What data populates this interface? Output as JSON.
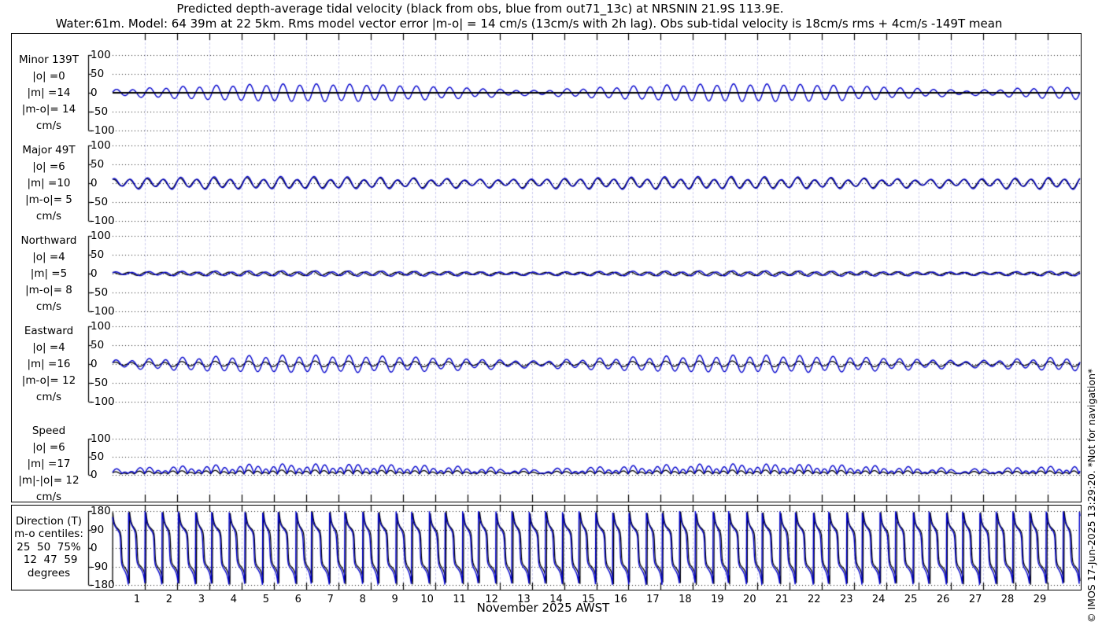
{
  "title": {
    "line1": "Predicted depth-average tidal velocity (black from obs, blue from out71_13c) at NRSNIN 21.9S 113.9E.",
    "line2": "Water:61m. Model: 64 39m at 22 5km. Rms model vector error |m-o| = 14 cm/s (13cm/s with 2h lag). Obs sub-tidal velocity is 18cm/s rms + 4cm/s -149T mean"
  },
  "x_axis": {
    "day_labels": [
      1,
      2,
      3,
      4,
      5,
      6,
      7,
      8,
      9,
      10,
      11,
      12,
      13,
      14,
      15,
      16,
      17,
      18,
      19,
      20,
      21,
      22,
      23,
      24,
      25,
      26,
      27,
      28,
      29
    ],
    "month_label": "November 2025 AWST",
    "n_days": 30
  },
  "watermark": "© IMOS 17-Jun-2025 13:29:20. *Not for navigation*",
  "colors": {
    "obs": "#000000",
    "model": "#0000cc",
    "day_grid": "#ccccee",
    "h_grid": "#222222",
    "border": "#000000"
  },
  "legend": {
    "obs_label": "black from obs",
    "model_label": "blue from out71_13c"
  },
  "chart_data": [
    {
      "type": "line",
      "id": "minor",
      "label_lines": [
        "Minor 139T",
        "|o| =0",
        "|m| =14",
        "|m-o|= 14",
        "cm/s"
      ],
      "units": "cm/s",
      "ylim": [
        -100,
        100
      ],
      "yticks": [
        100,
        50,
        0,
        -50,
        -100
      ],
      "series": [
        {
          "name": "obs",
          "type": "flat",
          "value": 0
        },
        {
          "name": "model",
          "type": "tidal",
          "amp_base": 5,
          "amp_beat": 17,
          "beat_period": 13.6,
          "beat_phase": 0.6,
          "m2_phase": 0.2,
          "k1_amp": 2
        }
      ]
    },
    {
      "type": "line",
      "id": "major",
      "label_lines": [
        "Major 49T",
        "|o| =6",
        "|m| =10",
        "|m-o|= 5",
        "cm/s"
      ],
      "units": "cm/s",
      "ylim": [
        -100,
        100
      ],
      "yticks": [
        100,
        50,
        0,
        -50,
        -100
      ],
      "series": [
        {
          "name": "obs",
          "type": "tidal",
          "amp_base": 8,
          "amp_beat": 4,
          "beat_period": 13.6,
          "beat_phase": 2.0,
          "m2_phase": 1.35,
          "k1_amp": 3
        },
        {
          "name": "model",
          "type": "tidal",
          "amp_base": 9,
          "amp_beat": 5,
          "beat_period": 13.6,
          "beat_phase": 2.0,
          "m2_phase": 1.1,
          "k1_amp": 4
        }
      ]
    },
    {
      "type": "line",
      "id": "northward",
      "label_lines": [
        "Northward",
        "|o| =4",
        "|m| =5",
        "|m-o|= 8",
        "cm/s"
      ],
      "units": "cm/s",
      "ylim": [
        -100,
        100
      ],
      "yticks": [
        100,
        50,
        0,
        -50,
        -100
      ],
      "series": [
        {
          "name": "obs",
          "type": "tidal",
          "amp_base": 3,
          "amp_beat": 2,
          "beat_period": 13.6,
          "beat_phase": 0.6,
          "m2_phase": 1.6,
          "k1_amp": 1.2
        },
        {
          "name": "model",
          "type": "tidal",
          "amp_base": 3.5,
          "amp_beat": 2.5,
          "beat_period": 13.6,
          "beat_phase": 0.6,
          "m2_phase": 0.5,
          "k1_amp": 1.5
        }
      ]
    },
    {
      "type": "line",
      "id": "eastward",
      "label_lines": [
        "Eastward",
        "|o| =4",
        "|m| =16",
        "|m-o|= 12",
        "cm/s"
      ],
      "units": "cm/s",
      "ylim": [
        -100,
        100
      ],
      "yticks": [
        100,
        50,
        0,
        -50,
        -100
      ],
      "series": [
        {
          "name": "obs",
          "type": "tidal",
          "amp_base": 4,
          "amp_beat": 2.5,
          "beat_period": 13.6,
          "beat_phase": 0.6,
          "m2_phase": 0.7,
          "k1_amp": 1.5
        },
        {
          "name": "model",
          "type": "tidal",
          "amp_base": 7,
          "amp_beat": 14,
          "beat_period": 13.6,
          "beat_phase": 0.6,
          "m2_phase": 0.4,
          "k1_amp": 3
        }
      ]
    },
    {
      "type": "line",
      "id": "speed",
      "label_lines": [
        "Speed",
        "|o| =6",
        "|m| =17",
        "|m|-|o|= 12",
        "cm/s"
      ],
      "units": "cm/s",
      "ylim": [
        0,
        110
      ],
      "yticks": [
        100,
        50,
        0
      ],
      "series": [
        {
          "name": "obs",
          "type": "speed",
          "subtidal": 2.5,
          "amp_base": 4,
          "amp_beat": 4,
          "beat_period": 13.6,
          "beat_phase": 0.6,
          "m2_phase": 0.7,
          "k1_amp": 3
        },
        {
          "name": "model",
          "type": "speed",
          "subtidal": 4,
          "amp_base": 6,
          "amp_beat": 14,
          "beat_period": 13.6,
          "beat_phase": 0.6,
          "m2_phase": 0.4,
          "k1_amp": 7
        }
      ]
    },
    {
      "type": "line",
      "id": "direction",
      "label_lines": [
        "Direction (T)",
        "m-o centiles:",
        "25  50  75%",
        " 12  47  59",
        "degrees"
      ],
      "units": "degrees true",
      "ylim": [
        -180,
        180
      ],
      "yticks": [
        180,
        90,
        0,
        -90,
        -180
      ],
      "series": [
        {
          "name": "obs",
          "type": "direction",
          "rot": 92,
          "ellipse": 0.3,
          "mean_v": 0.15,
          "m2_phase": -0.05,
          "k1_frac": 0.2
        },
        {
          "name": "model",
          "type": "direction",
          "rot": 88,
          "ellipse": 0.38,
          "mean_v": 0.22,
          "m2_phase": 0.3,
          "k1_frac": 0.25
        }
      ]
    }
  ]
}
